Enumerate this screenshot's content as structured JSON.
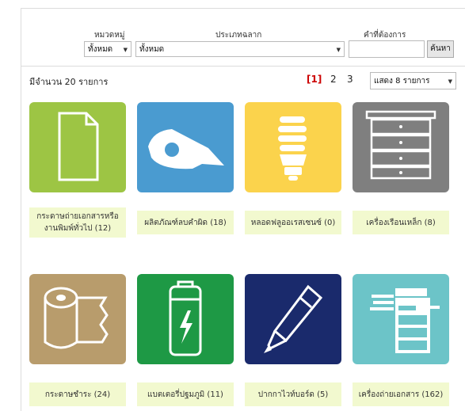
{
  "filters": {
    "category_label": "หมวดหมู่",
    "category_value": "ทั้งหมด",
    "type_label": "ประเภทฉลาก",
    "type_value": "ทั้งหมด",
    "keyword_label": "คำที่ต้องการ",
    "keyword_value": "",
    "search_button": "ค้นหา"
  },
  "listing": {
    "count_text": "มีจำนวน 20 รายการ",
    "pages": [
      "[1]",
      "2",
      "3"
    ],
    "active_page": "[1]",
    "per_page": "แสดง 8 รายการ"
  },
  "items": [
    {
      "caption": "กระดาษถ่ายเอกสารหรืองานพิมพ์ทั่วไป (12)",
      "icon": "paper-icon",
      "color": "#9dc544"
    },
    {
      "caption": "ผลิตภัณฑ์ลบคำผิด (18)",
      "icon": "correction-tape-icon",
      "color": "#4a9bd0"
    },
    {
      "caption": "หลอดฟลูออเรสเซนซ์ (0)",
      "icon": "fluorescent-bulb-icon",
      "color": "#fbd34c"
    },
    {
      "caption": "เครื่องเรือนเหล็ก (8)",
      "icon": "steel-cabinet-icon",
      "color": "#7f7f7f"
    },
    {
      "caption": "กระดาษชำระ (24)",
      "icon": "toilet-paper-icon",
      "color": "#b89c6c"
    },
    {
      "caption": "แบตเตอรี่ปฐมภูมิ (11)",
      "icon": "battery-icon",
      "color": "#1e9945"
    },
    {
      "caption": "ปากกาไวท์บอร์ด (5)",
      "icon": "whiteboard-marker-icon",
      "color": "#1a2a6c"
    },
    {
      "caption": "เครื่องถ่ายเอกสาร (162)",
      "icon": "photocopier-icon",
      "color": "#6cc4c8"
    }
  ]
}
